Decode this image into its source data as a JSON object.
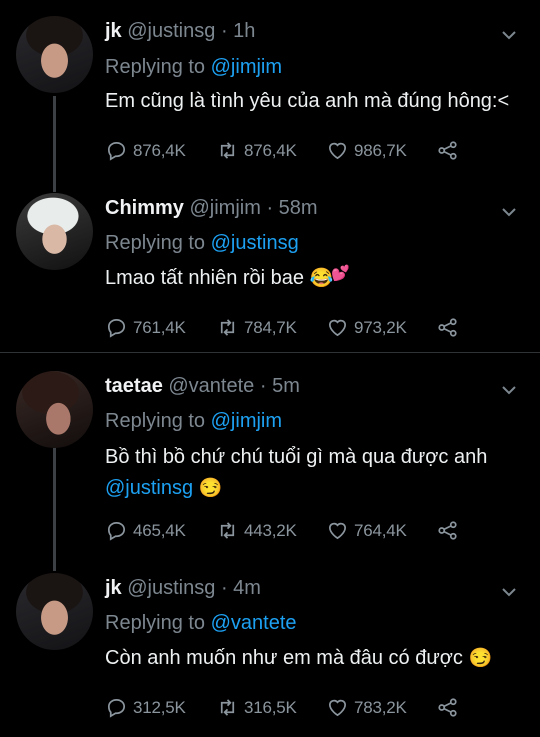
{
  "tweets": [
    {
      "name": "jk",
      "handle": "@justinsg",
      "time": "1h",
      "replying_label": "Replying to",
      "replying_to": "@jimjim",
      "text": "Em cũng là tình yêu của anh mà đúng hông:<",
      "replies": "876,4K",
      "retweets": "876,4K",
      "likes": "986,7K"
    },
    {
      "name": "Chimmy",
      "handle": "@jimjim",
      "time": "58m",
      "replying_label": "Replying to",
      "replying_to": "@justinsg",
      "text": "Lmao tất nhiên rồi bae",
      "emoji": "😂",
      "emoji2": "💕",
      "replies": "761,4K",
      "retweets": "784,7K",
      "likes": "973,2K"
    },
    {
      "name": "taetae",
      "handle": "@vantete",
      "time": "5m",
      "replying_label": "Replying to",
      "replying_to": "@jimjim",
      "text": "Bồ thì bồ chứ chú tuổi gì mà qua được anh",
      "mention_in_text": "@justinsg",
      "emoji": "😏",
      "replies": "465,4K",
      "retweets": "443,2K",
      "likes": "764,4K"
    },
    {
      "name": "jk",
      "handle": "@justinsg",
      "time": "4m",
      "replying_label": "Replying to",
      "replying_to": "@vantete",
      "text": "Còn anh muốn như em mà đâu có được",
      "emoji": "😏",
      "replies": "312,5K",
      "retweets": "316,5K",
      "likes": "783,2K"
    }
  ],
  "separator": "·",
  "icons": {
    "reply": "reply-icon",
    "retweet": "retweet-icon",
    "like": "heart-icon",
    "share": "share-icon",
    "menu": "chevron-down-icon"
  },
  "colors": {
    "background": "#000000",
    "mention": "#1da1f2",
    "muted": "#7d8790",
    "thread_line": "#3d4044"
  }
}
